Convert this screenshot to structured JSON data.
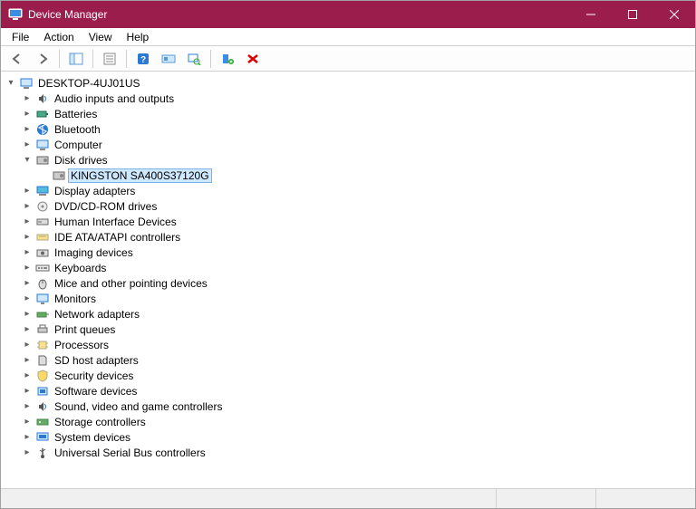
{
  "window": {
    "title": "Device Manager"
  },
  "menu": {
    "file": "File",
    "action": "Action",
    "view": "View",
    "help": "Help"
  },
  "toolbar": {
    "back": "Back",
    "forward": "Forward",
    "show_hide": "Show/Hide Console Tree",
    "properties": "Properties",
    "help": "Help",
    "update": "Update Driver",
    "scan": "Scan for hardware changes",
    "uninstall": "Uninstall device",
    "disable": "Disable device"
  },
  "tree": {
    "root": "DESKTOP-4UJ01US",
    "audio": "Audio inputs and outputs",
    "batteries": "Batteries",
    "bluetooth": "Bluetooth",
    "computer": "Computer",
    "disk_drives": "Disk drives",
    "disk_child_0": "KINGSTON SA400S37120G",
    "display": "Display adapters",
    "dvd": "DVD/CD-ROM drives",
    "hid": "Human Interface Devices",
    "ide": "IDE ATA/ATAPI controllers",
    "imaging": "Imaging devices",
    "keyboards": "Keyboards",
    "mice": "Mice and other pointing devices",
    "monitors": "Monitors",
    "network": "Network adapters",
    "print_queues": "Print queues",
    "processors": "Processors",
    "sd_host": "SD host adapters",
    "security": "Security devices",
    "software": "Software devices",
    "sound": "Sound, video and game controllers",
    "storage_ctrl": "Storage controllers",
    "system": "System devices",
    "usb": "Universal Serial Bus controllers"
  }
}
